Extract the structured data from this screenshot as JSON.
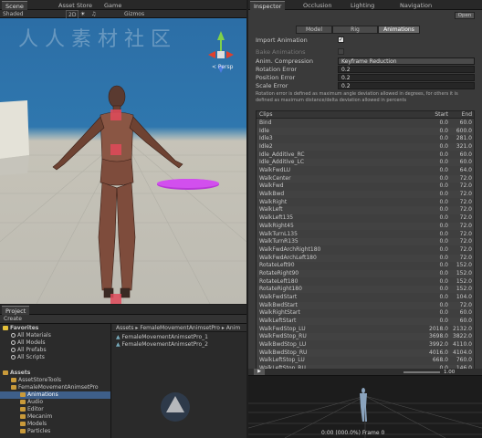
{
  "scene": {
    "tabs": [
      "Scene",
      "Asset Store",
      "Game"
    ],
    "shading": "Shaded",
    "mode_2d": "2D",
    "gizmos": "Gizmos",
    "persp": "< Persp"
  },
  "inspector": {
    "tabs": [
      "Inspector",
      "Occlusion",
      "Lighting",
      "Navigation"
    ],
    "open_label": "Open",
    "subtabs": [
      "Model",
      "Rig",
      "Animations"
    ],
    "import_animation": "Import Animation",
    "bake_animations": "Bake Animations",
    "anim_compression": "Anim. Compression",
    "anim_compression_value": "Keyframe Reduction",
    "rotation_error": "Rotation Error",
    "rotation_error_value": "0.2",
    "position_error": "Position Error",
    "position_error_value": "0.2",
    "scale_error": "Scale Error",
    "scale_error_value": "0.2",
    "help_line1": "Rotation error is defined as maximum angle deviation allowed in degrees, for others it is",
    "help_line2": "defined as maximum distance/delta deviation allowed in percents",
    "col_clips": "Clips",
    "col_start": "Start",
    "col_end": "End",
    "clips": [
      [
        "Bind",
        "0.0",
        "60.0"
      ],
      [
        "Idle",
        "0.0",
        "600.0"
      ],
      [
        "Idle3",
        "0.0",
        "281.0"
      ],
      [
        "Idle2",
        "0.0",
        "321.0"
      ],
      [
        "Idle_Additive_RC",
        "0.0",
        "60.0"
      ],
      [
        "Idle_Additive_LC",
        "0.0",
        "60.0"
      ],
      [
        "WalkFwdLU",
        "0.0",
        "64.0"
      ],
      [
        "WalkCenter",
        "0.0",
        "72.0"
      ],
      [
        "WalkFwd",
        "0.0",
        "72.0"
      ],
      [
        "WalkBwd",
        "0.0",
        "72.0"
      ],
      [
        "WalkRight",
        "0.0",
        "72.0"
      ],
      [
        "WalkLeft",
        "0.0",
        "72.0"
      ],
      [
        "WalkLeft135",
        "0.0",
        "72.0"
      ],
      [
        "WalkRight45",
        "0.0",
        "72.0"
      ],
      [
        "WalkTurnL135",
        "0.0",
        "72.0"
      ],
      [
        "WalkTurnR135",
        "0.0",
        "72.0"
      ],
      [
        "WalkFwdArchRight180",
        "0.0",
        "72.0"
      ],
      [
        "WalkFwdArchLeft180",
        "0.0",
        "72.0"
      ],
      [
        "RotateLeft90",
        "0.0",
        "152.0"
      ],
      [
        "RotateRight90",
        "0.0",
        "152.0"
      ],
      [
        "RotateLeft180",
        "0.0",
        "152.0"
      ],
      [
        "RotateRight180",
        "0.0",
        "152.0"
      ],
      [
        "WalkFwdStart",
        "0.0",
        "104.0"
      ],
      [
        "WalkBwdStart",
        "0.0",
        "72.0"
      ],
      [
        "WalkRightStart",
        "0.0",
        "60.0"
      ],
      [
        "WalkLeftStart",
        "0.0",
        "60.0"
      ],
      [
        "WalkFwdStop_LU",
        "2018.0",
        "2132.0"
      ],
      [
        "WalkFwdStop_RU",
        "3698.0",
        "3822.0"
      ],
      [
        "WalkBwdStop_LU",
        "3992.0",
        "4110.0"
      ],
      [
        "WalkBwdStop_RU",
        "4016.0",
        "4104.0"
      ],
      [
        "WalkLeftStop_LU",
        "668.0",
        "760.0"
      ],
      [
        "WalkLeftStop_RU",
        "0.0",
        "146.0"
      ]
    ]
  },
  "project": {
    "title": "Project",
    "create": "Create",
    "breadcrumb": "Assets ▸ FemaleMovementAnimsetPro ▸ Anim",
    "favorites_label": "Favorites",
    "favorites": [
      "All Materials",
      "All Models",
      "All Prefabs",
      "All Scripts"
    ],
    "assets_label": "Assets",
    "tree": [
      "AssetStoreTools",
      "FemaleMovementAnimsetPro",
      "Animations",
      "Audio",
      "Editor",
      "Mecanim",
      "Models",
      "Particles"
    ],
    "files": [
      "FemaleMovementAnimsetPro_1",
      "FemaleMovementAnimsetPro_2"
    ]
  },
  "preview": {
    "speed": "1.00",
    "status": "0:00 (000.0%) Frame 0"
  },
  "watermark": "人人素材"
}
